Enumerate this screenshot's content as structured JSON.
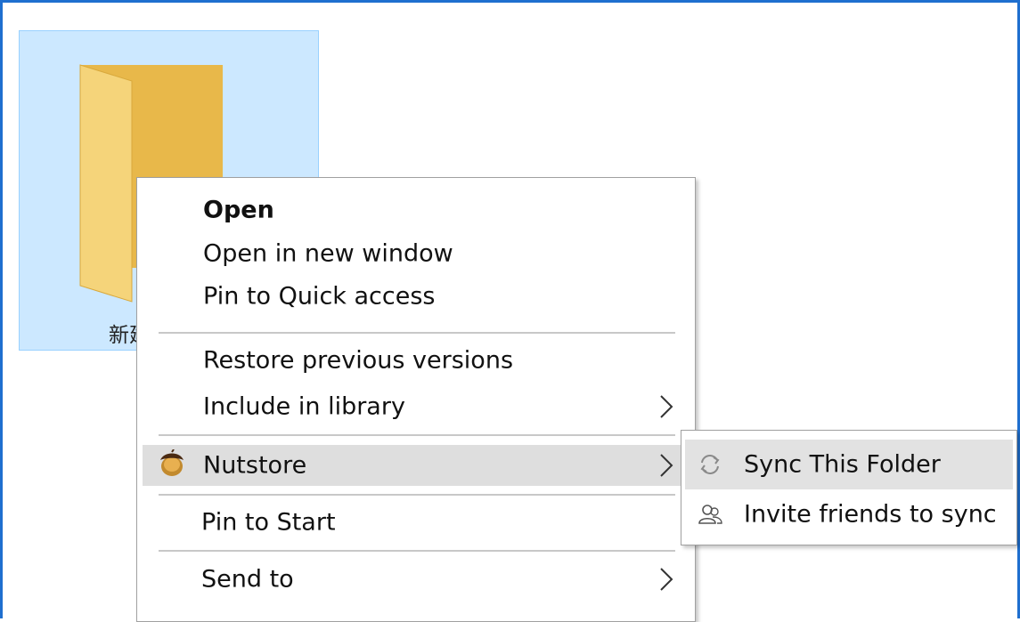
{
  "folder": {
    "label": "新建文件夹",
    "colors": {
      "front": "#f5d47a",
      "back": "#e8b84a",
      "selection": "#cce8ff"
    }
  },
  "context_menu": {
    "items": [
      {
        "label": "Open",
        "bold": true
      },
      {
        "label": "Open in new window"
      },
      {
        "label": "Pin to Quick access"
      },
      {
        "label": "Restore previous versions"
      },
      {
        "label": "Include in library",
        "submenu": true
      },
      {
        "label": "Nutstore",
        "icon": "acorn-icon",
        "submenu": true,
        "highlighted": true
      },
      {
        "label": "Pin to Start"
      },
      {
        "label": "Send to",
        "submenu": true
      }
    ]
  },
  "nutstore_submenu": {
    "items": [
      {
        "label": "Sync This Folder",
        "icon": "sync-icon",
        "highlighted": true
      },
      {
        "label": "Invite friends to sync",
        "icon": "invite-friends-icon"
      }
    ]
  },
  "colors": {
    "window_border": "#1f6fcf",
    "hover": "#dedede"
  }
}
